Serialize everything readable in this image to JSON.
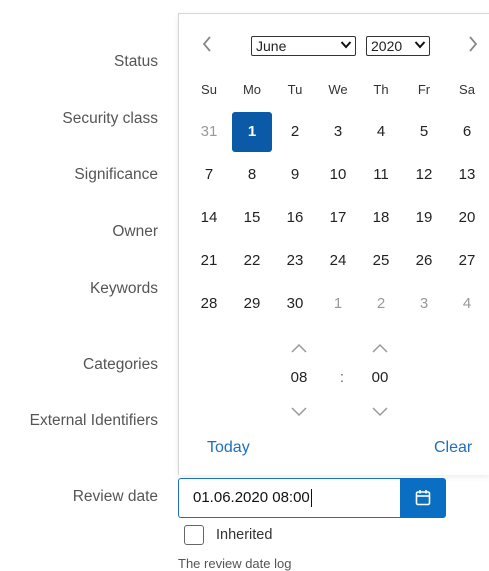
{
  "form": {
    "labels": [
      "Status",
      "Security class",
      "Significance",
      "Owner",
      "Keywords",
      "Categories",
      "External Identifiers",
      "Review date"
    ],
    "review_date_value": "01.06.2020 08:00",
    "inherited_label": "Inherited",
    "inherited_checked": false,
    "review_log_text": "The review date log"
  },
  "picker": {
    "prev_icon": "chevron-left-icon",
    "next_icon": "chevron-right-icon",
    "month": "June",
    "year": "2020",
    "weekdays": [
      "Su",
      "Mo",
      "Tu",
      "We",
      "Th",
      "Fr",
      "Sa"
    ],
    "weeks": [
      [
        "31",
        "1",
        "2",
        "3",
        "4",
        "5",
        "6"
      ],
      [
        "7",
        "8",
        "9",
        "10",
        "11",
        "12",
        "13"
      ],
      [
        "14",
        "15",
        "16",
        "17",
        "18",
        "19",
        "20"
      ],
      [
        "21",
        "22",
        "23",
        "24",
        "25",
        "26",
        "27"
      ],
      [
        "28",
        "29",
        "30",
        "1",
        "2",
        "3",
        "4"
      ]
    ],
    "selected_day": "1",
    "hour": "08",
    "minute": "00",
    "time_separator": ":",
    "today_label": "Today",
    "clear_label": "Clear"
  },
  "colors": {
    "accent": "#0a6fc2",
    "selected_day_bg": "#0a5aa8",
    "link": "#1f6fbd"
  }
}
